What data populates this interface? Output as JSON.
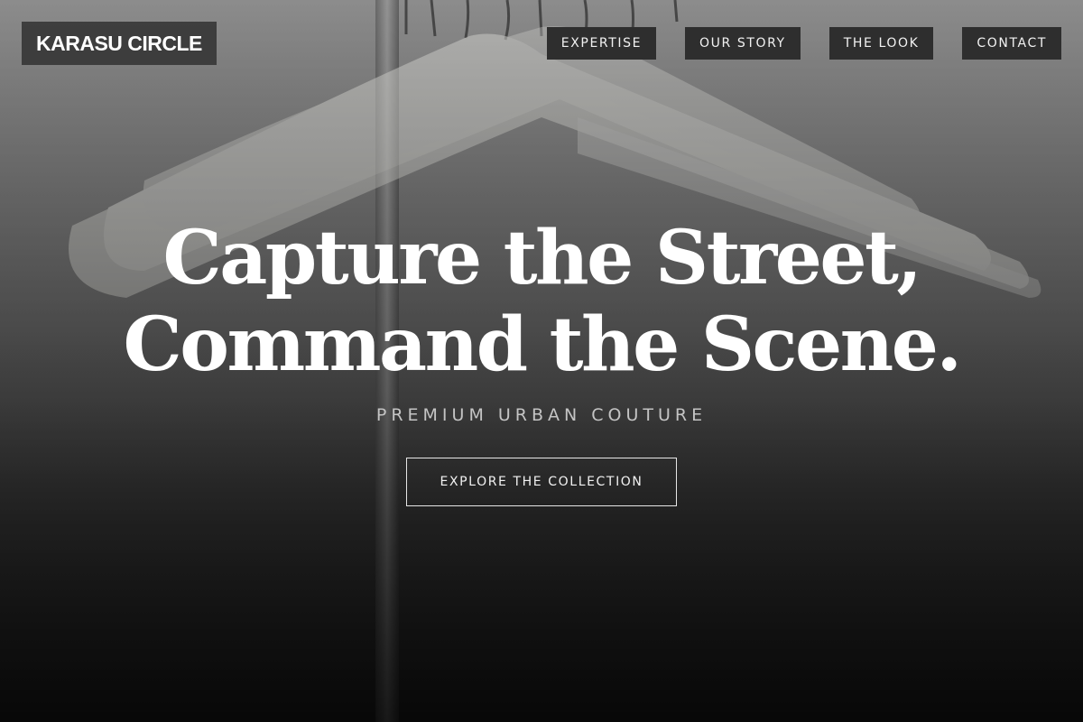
{
  "brand": {
    "name": "KARASU CIRCLE"
  },
  "nav": {
    "items": [
      {
        "label": "EXPERTISE"
      },
      {
        "label": "OUR STORY"
      },
      {
        "label": "THE LOOK"
      },
      {
        "label": "CONTACT"
      }
    ]
  },
  "hero": {
    "headline_line1": "Capture the Street,",
    "headline_line2": "Command the Scene.",
    "tagline": "PREMIUM URBAN COUTURE",
    "cta_label": "EXPLORE THE COLLECTION",
    "background_image": "white-hangers-on-clothing-rack"
  },
  "colors": {
    "nav_background": "#2e2e2e",
    "logo_background": "#373737",
    "headline": "#ffffff",
    "tagline": "#c4c4c4"
  }
}
